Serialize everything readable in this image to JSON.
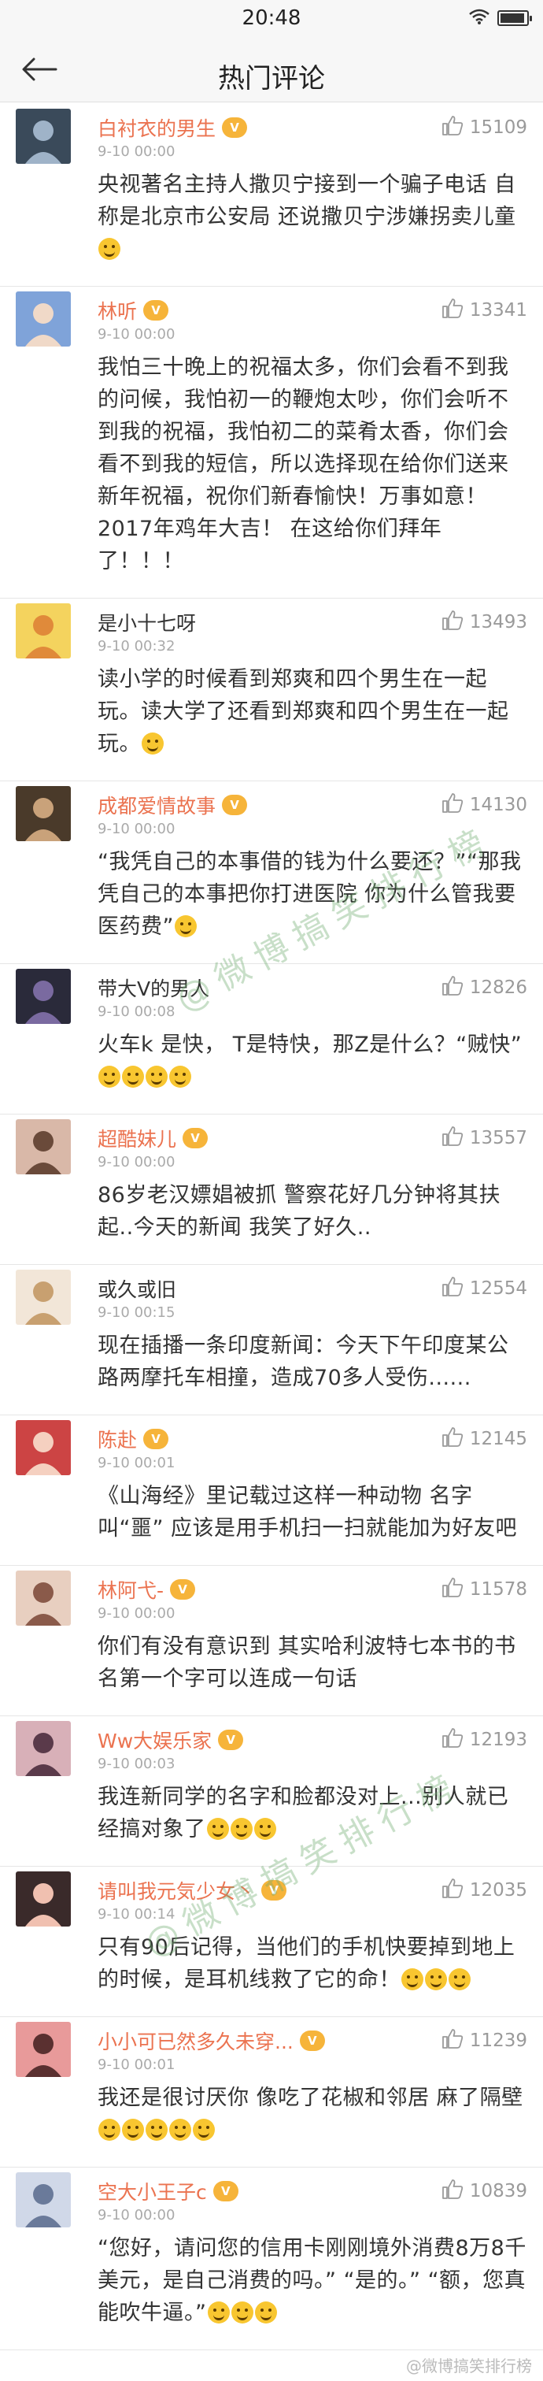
{
  "status_bar": {
    "time": "20:48"
  },
  "nav": {
    "title": "热门评论"
  },
  "comments": [
    {
      "name": "白衬衣的男生",
      "vip": true,
      "likes": "15109",
      "time": "9-10 00:00",
      "text": "央视著名主持人撒贝宁接到一个骗子电话 自称是北京市公安局 还说撒贝宁涉嫌拐卖儿童",
      "emoji": 1
    },
    {
      "name": "林听",
      "vip": true,
      "likes": "13341",
      "time": "9-10 00:00",
      "text": "我怕三十晚上的祝福太多，你们会看不到我的问候，我怕初一的鞭炮太吵，你们会听不到我的祝福，我怕初二的菜肴太香，你们会看不到我的短信，所以选择现在给你们送来新年祝福，祝你们新春愉快！万事如意！2017年鸡年大吉！ 在这给你们拜年了！！！",
      "emoji": 0
    },
    {
      "name": "是小十七呀",
      "vip": false,
      "likes": "13493",
      "time": "9-10 00:32",
      "text": "读小学的时候看到郑爽和四个男生在一起玩。读大学了还看到郑爽和四个男生在一起玩。",
      "emoji": 1
    },
    {
      "name": "成都爱情故事",
      "vip": true,
      "likes": "14130",
      "time": "9-10 00:00",
      "text": "“我凭自己的本事借的钱为什么要还？”“那我凭自己的本事把你打进医院 你为什么管我要医药费”",
      "emoji": 1
    },
    {
      "name": "带大V的男人",
      "vip": false,
      "likes": "12826",
      "time": "9-10 00:08",
      "text": "火车k 是快， T是特快，那Z是什么？“贼快”",
      "emoji": 4
    },
    {
      "name": "超酷妹儿",
      "vip": true,
      "likes": "13557",
      "time": "9-10 00:00",
      "text": "86岁老汉嫖娼被抓 警察花好几分钟将其扶起..今天的新闻 我笑了好久..",
      "emoji": 0
    },
    {
      "name": "或久或旧",
      "vip": false,
      "likes": "12554",
      "time": "9-10 00:15",
      "text": "现在插播一条印度新闻：今天下午印度某公路两摩托车相撞，造成70多人受伤......",
      "emoji": 0
    },
    {
      "name": "陈赴",
      "vip": true,
      "likes": "12145",
      "time": "9-10 00:01",
      "text": "《山海经》里记载过这样一种动物 名字叫“噩” 应该是用手机扫一扫就能加为好友吧",
      "emoji": 0
    },
    {
      "name": "林阿弋-",
      "vip": true,
      "likes": "11578",
      "time": "9-10 00:00",
      "text": "你们有没有意识到 其实哈利波特七本书的书名第一个字可以连成一句话",
      "emoji": 0
    },
    {
      "name": "Ww大娱乐家",
      "vip": true,
      "likes": "12193",
      "time": "9-10 00:03",
      "text": "我连新同学的名字和脸都没对上...别人就已经搞对象了",
      "emoji": 3
    },
    {
      "name": "请叫我元気少女丶",
      "vip": true,
      "likes": "12035",
      "time": "9-10 00:14",
      "text": "只有90后记得，当他们的手机快要掉到地上的时候，是耳机线救了它的命！",
      "emoji": 3
    },
    {
      "name": "小小可已然多久未穿...",
      "vip": true,
      "likes": "11239",
      "time": "9-10 00:01",
      "text": "我还是很讨厌你 像吃了花椒和邻居 麻了隔壁",
      "emoji": 5
    },
    {
      "name": "空大小王子c",
      "vip": true,
      "likes": "10839",
      "time": "9-10 00:00",
      "text": "“您好，请问您的信用卡刚刚境外消费8万8千美元，是自己消费的吗。” “是的。” “额，您真能吹牛逼。”",
      "emoji": 3
    }
  ],
  "watermark": {
    "text": "@微博搞笑排行榜"
  },
  "corner_mark": {
    "text": "@微博搞笑排行榜"
  },
  "colors": {
    "name": "#eb7350",
    "vip": "#f6b43a",
    "like": "#9a9a9a"
  }
}
